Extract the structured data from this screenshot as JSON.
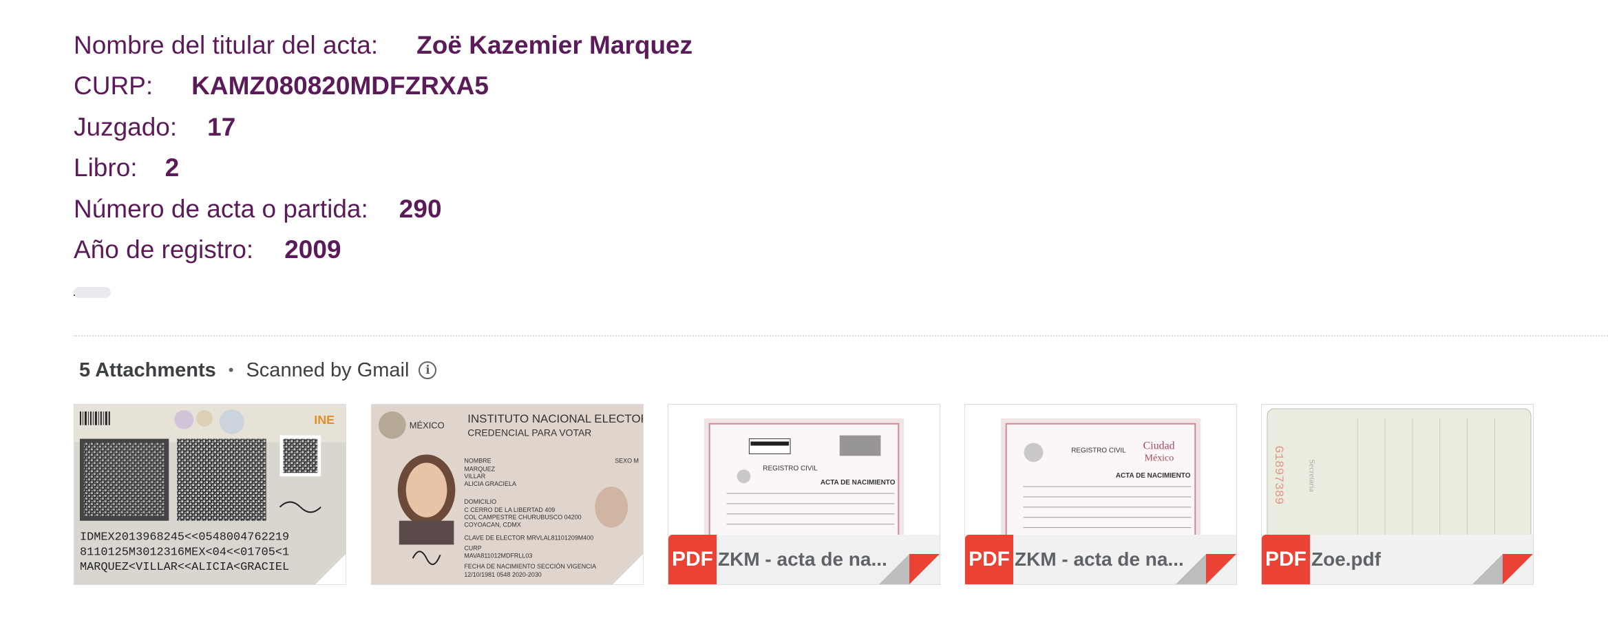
{
  "fields": [
    {
      "label": "Nombre del titular del acta:",
      "value": "Zoë Kazemier Marquez"
    },
    {
      "label": "CURP:",
      "value": "KAMZ080820MDFZRXA5"
    },
    {
      "label": "Juzgado:",
      "value": "17"
    },
    {
      "label": "Libro:",
      "value": "2"
    },
    {
      "label": "Número de acta o partida:",
      "value": "290"
    },
    {
      "label": "Año de registro:",
      "value": "2009"
    }
  ],
  "attachments_header": {
    "count_label": "5 Attachments",
    "separator": "•",
    "scan_label": "Scanned by Gmail",
    "info_icon": "info-icon"
  },
  "attachments": [
    {
      "kind": "image",
      "icon": "id-card-back-thumbnail",
      "ocr": "IDMEX2013968245<<0548004762219"
    },
    {
      "kind": "image",
      "icon": "id-card-front-thumbnail",
      "title": "INSTITUTO NACIONAL ELECTORAL",
      "subtitle": "CREDENCIAL PARA VOTAR",
      "country": "MÉXICO"
    },
    {
      "kind": "pdf",
      "badge": "PDF",
      "name": "ZKM - acta de na..."
    },
    {
      "kind": "pdf",
      "badge": "PDF",
      "name": "ZKM - acta de na..."
    },
    {
      "kind": "pdf",
      "badge": "PDF",
      "name": "Zoe.pdf"
    }
  ],
  "colors": {
    "field_text": "#5b1a58",
    "pdf_red": "#ea4335",
    "divider": "#dadce0"
  }
}
